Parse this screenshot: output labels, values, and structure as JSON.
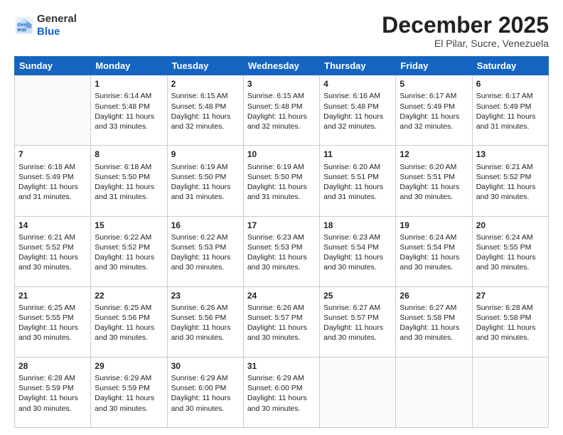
{
  "logo": {
    "general": "General",
    "blue": "Blue"
  },
  "header": {
    "month": "December 2025",
    "location": "El Pilar, Sucre, Venezuela"
  },
  "weekdays": [
    "Sunday",
    "Monday",
    "Tuesday",
    "Wednesday",
    "Thursday",
    "Friday",
    "Saturday"
  ],
  "weeks": [
    [
      {
        "day": "",
        "info": ""
      },
      {
        "day": "1",
        "info": "Sunrise: 6:14 AM\nSunset: 5:48 PM\nDaylight: 11 hours and 33 minutes."
      },
      {
        "day": "2",
        "info": "Sunrise: 6:15 AM\nSunset: 5:48 PM\nDaylight: 11 hours and 32 minutes."
      },
      {
        "day": "3",
        "info": "Sunrise: 6:15 AM\nSunset: 5:48 PM\nDaylight: 11 hours and 32 minutes."
      },
      {
        "day": "4",
        "info": "Sunrise: 6:16 AM\nSunset: 5:48 PM\nDaylight: 11 hours and 32 minutes."
      },
      {
        "day": "5",
        "info": "Sunrise: 6:17 AM\nSunset: 5:49 PM\nDaylight: 11 hours and 32 minutes."
      },
      {
        "day": "6",
        "info": "Sunrise: 6:17 AM\nSunset: 5:49 PM\nDaylight: 11 hours and 31 minutes."
      }
    ],
    [
      {
        "day": "7",
        "info": "Sunrise: 6:18 AM\nSunset: 5:49 PM\nDaylight: 11 hours and 31 minutes."
      },
      {
        "day": "8",
        "info": "Sunrise: 6:18 AM\nSunset: 5:50 PM\nDaylight: 11 hours and 31 minutes."
      },
      {
        "day": "9",
        "info": "Sunrise: 6:19 AM\nSunset: 5:50 PM\nDaylight: 11 hours and 31 minutes."
      },
      {
        "day": "10",
        "info": "Sunrise: 6:19 AM\nSunset: 5:50 PM\nDaylight: 11 hours and 31 minutes."
      },
      {
        "day": "11",
        "info": "Sunrise: 6:20 AM\nSunset: 5:51 PM\nDaylight: 11 hours and 31 minutes."
      },
      {
        "day": "12",
        "info": "Sunrise: 6:20 AM\nSunset: 5:51 PM\nDaylight: 11 hours and 30 minutes."
      },
      {
        "day": "13",
        "info": "Sunrise: 6:21 AM\nSunset: 5:52 PM\nDaylight: 11 hours and 30 minutes."
      }
    ],
    [
      {
        "day": "14",
        "info": "Sunrise: 6:21 AM\nSunset: 5:52 PM\nDaylight: 11 hours and 30 minutes."
      },
      {
        "day": "15",
        "info": "Sunrise: 6:22 AM\nSunset: 5:52 PM\nDaylight: 11 hours and 30 minutes."
      },
      {
        "day": "16",
        "info": "Sunrise: 6:22 AM\nSunset: 5:53 PM\nDaylight: 11 hours and 30 minutes."
      },
      {
        "day": "17",
        "info": "Sunrise: 6:23 AM\nSunset: 5:53 PM\nDaylight: 11 hours and 30 minutes."
      },
      {
        "day": "18",
        "info": "Sunrise: 6:23 AM\nSunset: 5:54 PM\nDaylight: 11 hours and 30 minutes."
      },
      {
        "day": "19",
        "info": "Sunrise: 6:24 AM\nSunset: 5:54 PM\nDaylight: 11 hours and 30 minutes."
      },
      {
        "day": "20",
        "info": "Sunrise: 6:24 AM\nSunset: 5:55 PM\nDaylight: 11 hours and 30 minutes."
      }
    ],
    [
      {
        "day": "21",
        "info": "Sunrise: 6:25 AM\nSunset: 5:55 PM\nDaylight: 11 hours and 30 minutes."
      },
      {
        "day": "22",
        "info": "Sunrise: 6:25 AM\nSunset: 5:56 PM\nDaylight: 11 hours and 30 minutes."
      },
      {
        "day": "23",
        "info": "Sunrise: 6:26 AM\nSunset: 5:56 PM\nDaylight: 11 hours and 30 minutes."
      },
      {
        "day": "24",
        "info": "Sunrise: 6:26 AM\nSunset: 5:57 PM\nDaylight: 11 hours and 30 minutes."
      },
      {
        "day": "25",
        "info": "Sunrise: 6:27 AM\nSunset: 5:57 PM\nDaylight: 11 hours and 30 minutes."
      },
      {
        "day": "26",
        "info": "Sunrise: 6:27 AM\nSunset: 5:58 PM\nDaylight: 11 hours and 30 minutes."
      },
      {
        "day": "27",
        "info": "Sunrise: 6:28 AM\nSunset: 5:58 PM\nDaylight: 11 hours and 30 minutes."
      }
    ],
    [
      {
        "day": "28",
        "info": "Sunrise: 6:28 AM\nSunset: 5:59 PM\nDaylight: 11 hours and 30 minutes."
      },
      {
        "day": "29",
        "info": "Sunrise: 6:29 AM\nSunset: 5:59 PM\nDaylight: 11 hours and 30 minutes."
      },
      {
        "day": "30",
        "info": "Sunrise: 6:29 AM\nSunset: 6:00 PM\nDaylight: 11 hours and 30 minutes."
      },
      {
        "day": "31",
        "info": "Sunrise: 6:29 AM\nSunset: 6:00 PM\nDaylight: 11 hours and 30 minutes."
      },
      {
        "day": "",
        "info": ""
      },
      {
        "day": "",
        "info": ""
      },
      {
        "day": "",
        "info": ""
      }
    ]
  ]
}
